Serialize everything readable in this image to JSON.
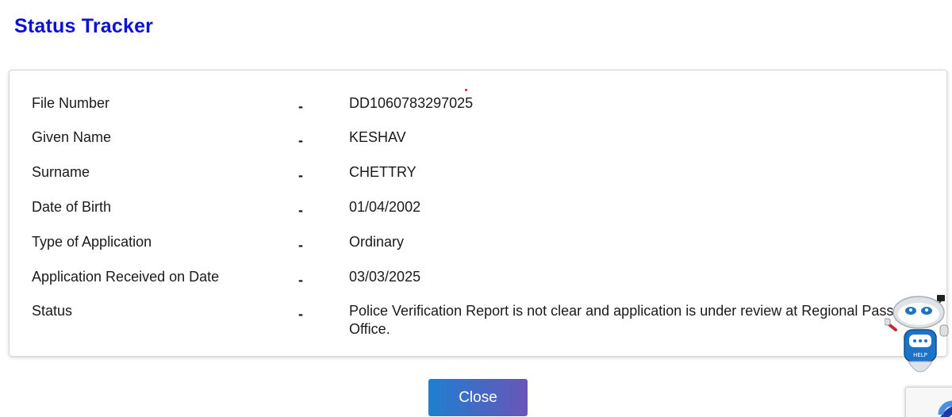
{
  "page": {
    "title": "Status Tracker"
  },
  "details": {
    "separator": "-",
    "rows": [
      {
        "label": "File Number",
        "value": "DD1060783297025"
      },
      {
        "label": "Given Name",
        "value": "KESHAV"
      },
      {
        "label": "Surname",
        "value": "CHETTRY"
      },
      {
        "label": "Date of Birth",
        "value": "01/04/2002"
      },
      {
        "label": "Type of Application",
        "value": "Ordinary"
      },
      {
        "label": "Application Received on Date",
        "value": "03/03/2025"
      },
      {
        "label": "Status",
        "value": "Police Verification Report is not clear and application is under review at Regional Passport Office."
      }
    ]
  },
  "actions": {
    "close_label": "Close"
  },
  "help_widget": {
    "label": "HELP",
    "icon": "robot-icon"
  },
  "recaptcha": {
    "icon": "recaptcha-icon"
  },
  "colors": {
    "title": "#0b12d6",
    "button_start": "#1e7fd0",
    "button_end": "#6a55b8",
    "robot_blue": "#1e73c8"
  }
}
